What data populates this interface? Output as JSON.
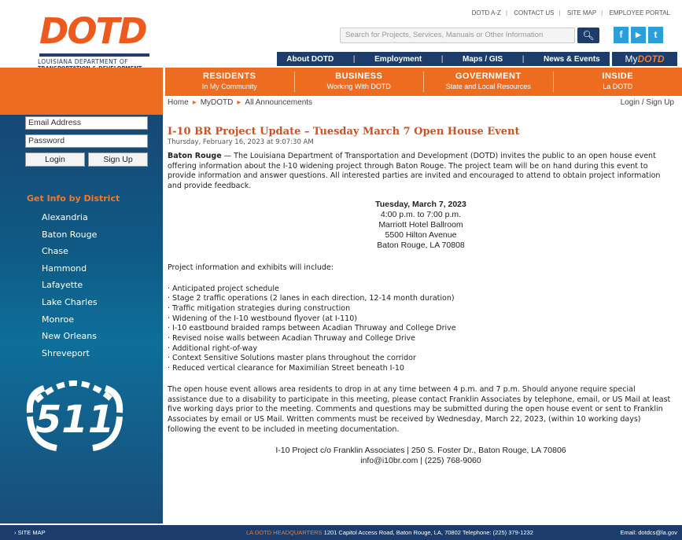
{
  "header": {
    "logo_text": "DOTD",
    "logo_sub1": "LOUISIANA DEPARTMENT OF",
    "logo_sub2": "TRANSPORTATION & DEVELOPMENT",
    "top_links": [
      "DOTD A-Z",
      "CONTACT US",
      "SITE MAP",
      "EMPLOYEE PORTAL"
    ],
    "search_placeholder": "Search for Projects, Services, Manuals or Other Information",
    "social": [
      "f",
      "▶",
      "t"
    ],
    "top_nav": [
      "About DOTD",
      "Employment",
      "Maps / GIS",
      "News & Events"
    ],
    "my_dotd": {
      "my": "My",
      "brand": "DOTD"
    }
  },
  "orange_nav": [
    {
      "main": "RESIDENTS",
      "sub": "In My Community"
    },
    {
      "main": "BUSINESS",
      "sub": "Working With DOTD"
    },
    {
      "main": "GOVERNMENT",
      "sub": "State and Local Resources"
    },
    {
      "main": "INSIDE",
      "sub": "La DOTD"
    }
  ],
  "sidebar": {
    "email_placeholder": "Email Address",
    "password_placeholder": "Password",
    "login": "Login",
    "signup": "Sign Up",
    "district_heading": "Get Info by District",
    "districts": [
      "Alexandria",
      "Baton Rouge",
      "Chase",
      "Hammond",
      "Lafayette",
      "Lake Charles",
      "Monroe",
      "New Orleans",
      "Shreveport"
    ],
    "logo_511": "511"
  },
  "breadcrumb": [
    "Home",
    "MyDOTD",
    "All Announcements"
  ],
  "login_links": "Login  / Sign Up",
  "article": {
    "title": "I-10 BR Project Update – Tuesday March 7 Open House Event",
    "date": "Thursday, February 16, 2023 at 9:07:30 AM",
    "lead_bold": "Baton Rouge",
    "lead": " — The Louisiana Department of Transportation and Development (DOTD) invites the public to an open house event offering information about the I-10 widening project through Baton Rouge. The project team will be on hand during this event to provide information and answer questions. All interested parties are invited and encouraged to attend to obtain project information and provide feedback.",
    "event_date": "Tuesday, March 7, 2023",
    "event_time": "4:00 p.m. to 7:00 p.m.",
    "event_place": "Marriott Hotel Ballroom",
    "event_street": "5500 Hilton Avenue",
    "event_city": "Baton Rouge, LA 70808",
    "items_intro": "Project information and exhibits will include:",
    "items": [
      "· Anticipated project schedule",
      "· Stage 2 traffic operations (2 lanes in each direction, 12-14 month duration)",
      "· Traffic mitigation strategies during construction",
      "· Widening of the I-10 westbound flyover (at I-110)",
      "· I-10 eastbound braided ramps between Acadian Thruway and College Drive",
      "· Revised noise walls between Acadian Thruway and College Drive",
      "· Additional right-of-way",
      "· Context Sensitive Solutions master plans throughout the corridor",
      "· Reduced vertical clearance for Maximilian Street beneath I-10"
    ],
    "closing": "The open house event allows area residents to drop in at any time between 4 p.m. and 7 p.m. Should anyone require special assistance due to a disability to participate in this meeting, please contact Franklin Associates by telephone, email, or US Mail at least five working days prior to the meeting. Comments and questions may be submitted during the open house event or sent to Franklin Associates by email or US Mail. Written comments must be received by Wednesday, March 22, 2023, (within 10 working days) following the event to be included in meeting documentation.",
    "contact1": "I-10 Project c/o Franklin Associates | 250 S. Foster Dr., Baton Rouge, LA 70806",
    "contact2": "info@i10br.com | (225) 768-9060"
  },
  "footer": {
    "sitemap": "› SITE MAP",
    "hq_label": "LA DOTD HEADQUARTERS",
    "hq_address": " 1201 Capitol Access Road, Baton Rouge, LA, 70802   Telephone: (225) 379-1232",
    "email": "Email: dotdcs@la.gov"
  },
  "colors": {
    "orange": "#ee6c1f",
    "navy": "#1c3d6c",
    "title": "#c9542a"
  }
}
